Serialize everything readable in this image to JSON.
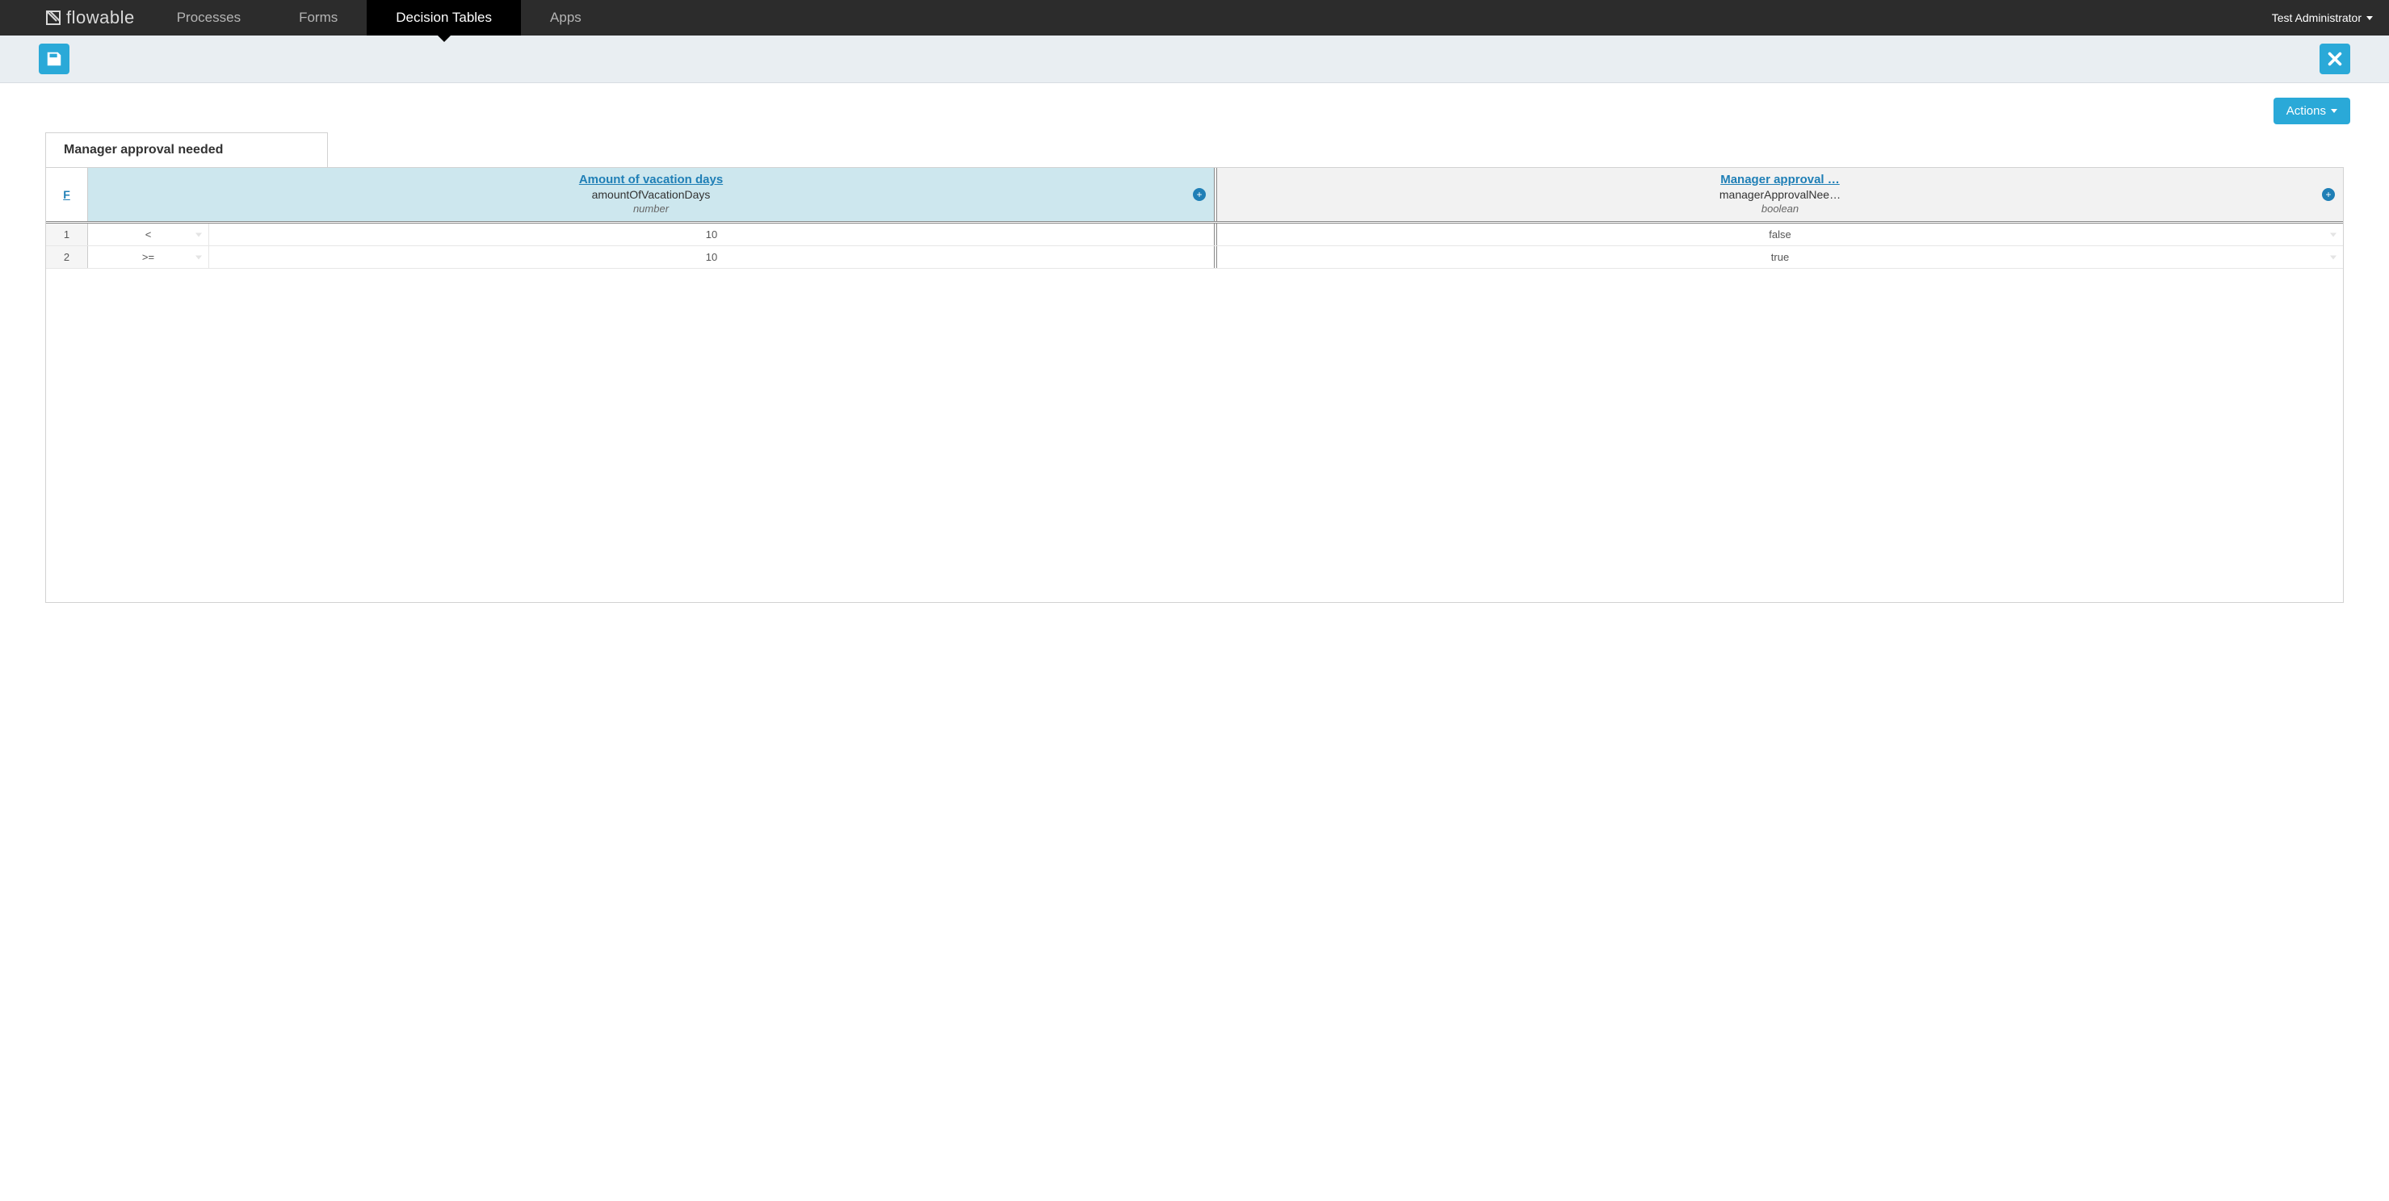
{
  "brand": "flowable",
  "nav": {
    "items": [
      {
        "label": "Processes"
      },
      {
        "label": "Forms"
      },
      {
        "label": "Decision Tables"
      },
      {
        "label": "Apps"
      }
    ],
    "active_index": 2
  },
  "user": "Test Administrator",
  "actions_button": "Actions",
  "tab_title": "Manager approval needed",
  "hit_policy_short": "F",
  "columns": {
    "inputs": [
      {
        "title": "Amount of vacation days",
        "variable": "amountOfVacationDays",
        "type": "number"
      }
    ],
    "outputs": [
      {
        "title": "Manager approval …",
        "variable": "managerApprovalNee…",
        "type": "boolean"
      }
    ]
  },
  "rows": [
    {
      "num": "1",
      "operator": "<",
      "input_value": "10",
      "output_value": "false"
    },
    {
      "num": "2",
      "operator": ">=",
      "input_value": "10",
      "output_value": "true"
    }
  ]
}
